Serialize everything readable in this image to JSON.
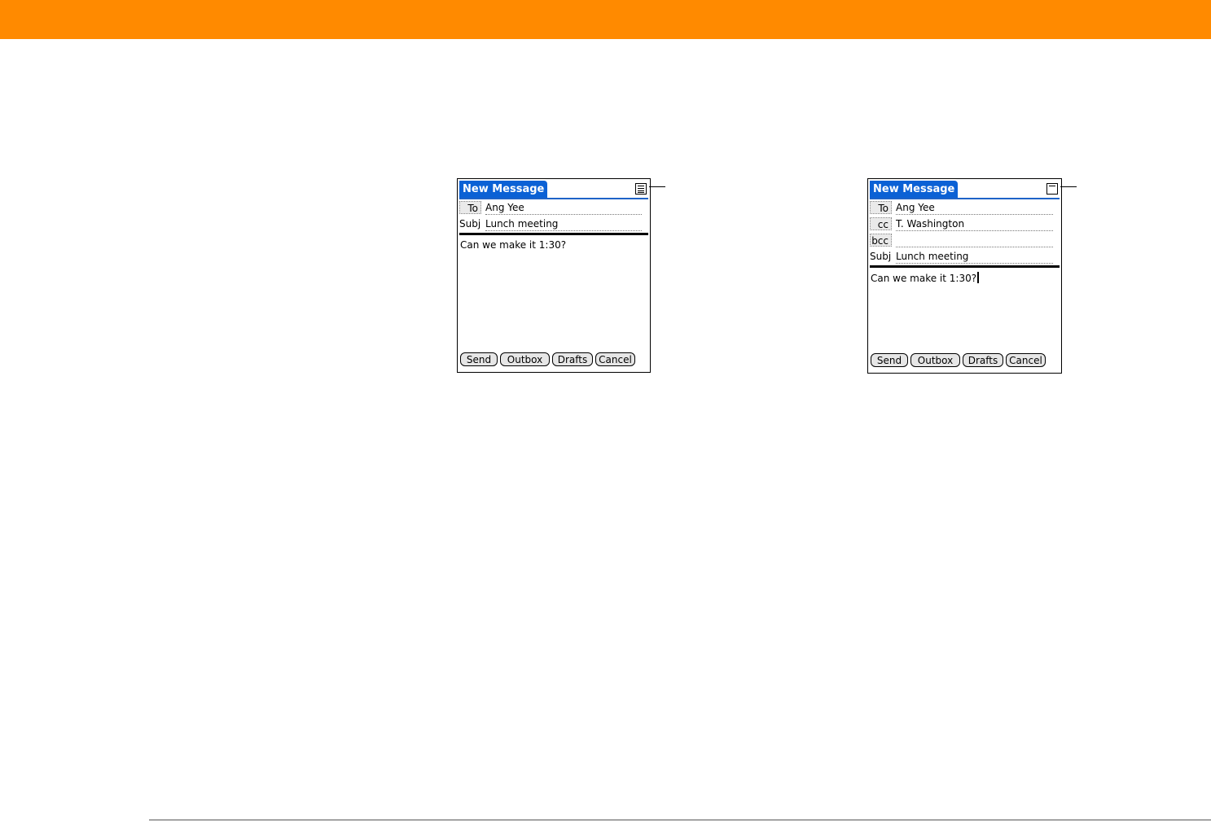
{
  "screen_left": {
    "title": "New Message",
    "icon": "details-icon",
    "fields": {
      "to_label": "To",
      "to_value": "Ang Yee",
      "subj_label": "Subj",
      "subj_value": "Lunch meeting"
    },
    "body": "Can we make it 1:30?",
    "buttons": {
      "send": "Send",
      "outbox": "Outbox",
      "drafts": "Drafts",
      "cancel": "Cancel"
    }
  },
  "screen_right": {
    "title": "New Message",
    "icon": "details-icon",
    "fields": {
      "to_label": "To",
      "to_value": "Ang Yee",
      "cc_label": "cc",
      "cc_value": "T. Washington",
      "bcc_label": "bcc",
      "bcc_value": "",
      "subj_label": "Subj",
      "subj_value": "Lunch meeting"
    },
    "body": "Can we make it 1:30?",
    "buttons": {
      "send": "Send",
      "outbox": "Outbox",
      "drafts": "Drafts",
      "cancel": "Cancel"
    }
  },
  "colors": {
    "header_bar": "#ff8a00",
    "title_tab": "#0b61d5"
  }
}
